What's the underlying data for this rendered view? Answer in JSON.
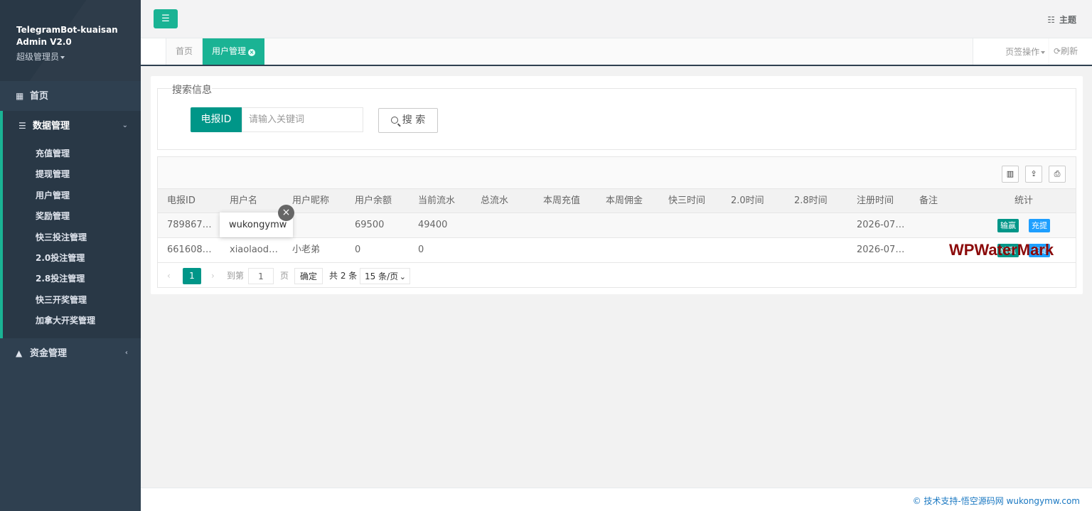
{
  "app": {
    "title_line1": "TelegramBot-kuaisan",
    "title_line2": "Admin V2.0",
    "role": "超级管理员"
  },
  "sidebar": {
    "home": "首页",
    "data_group": {
      "label": "数据管理",
      "items": [
        "充值管理",
        "提现管理",
        "用户管理",
        "奖励管理",
        "快三投注管理",
        "2.0投注管理",
        "2.8投注管理",
        "快三开奖管理",
        "加拿大开奖管理"
      ]
    },
    "funds": "资金管理"
  },
  "topbar": {
    "menu_icon": "bars-icon",
    "theme_label": "主题"
  },
  "tabs": {
    "home": "首页",
    "active": "用户管理",
    "ops": "页签操作",
    "refresh": "刷新"
  },
  "search": {
    "legend": "搜索信息",
    "field_label": "电报ID",
    "placeholder": "请输入关键词",
    "button": "搜 索"
  },
  "table": {
    "columns": [
      "电报ID",
      "用户名",
      "用户昵称",
      "用户余额",
      "当前流水",
      "总流水",
      "本周充值",
      "本周佣金",
      "快三时间",
      "2.0时间",
      "2.8时间",
      "注册时间",
      "备注",
      "统计"
    ],
    "rows": [
      {
        "tg_id": "789867…",
        "username": "",
        "nickname": "",
        "balance": "69500",
        "flow": "49400",
        "total_flow": "",
        "week_recharge": "",
        "week_commission": "",
        "k3_time": "",
        "t20_time": "",
        "t28_time": "",
        "reg_time": "2026-07…",
        "note": "",
        "btn1": "输赢",
        "btn2": "充提"
      },
      {
        "tg_id": "661608…",
        "username": "xiaolaod…",
        "nickname": "小老弟",
        "balance": "0",
        "flow": "0",
        "total_flow": "",
        "week_recharge": "",
        "week_commission": "",
        "k3_time": "",
        "t20_time": "",
        "t28_time": "",
        "reg_time": "2026-07…",
        "note": "",
        "btn1": "输赢",
        "btn2": "充提"
      }
    ]
  },
  "tooltip": {
    "text": "wukongymw"
  },
  "pager": {
    "current": "1",
    "goto_label": "到第",
    "goto_value": "1",
    "page_unit": "页",
    "confirm": "确定",
    "total": "共 2 条",
    "page_size": "15 条/页"
  },
  "watermark": "WPWaterMark",
  "footer": "© 技术支持-悟空源码网 wukongymw.com",
  "colors": {
    "sidebar_bg": "#2f4050",
    "accent": "#1ab394",
    "teal": "#009688",
    "blue": "#1e9fff"
  }
}
